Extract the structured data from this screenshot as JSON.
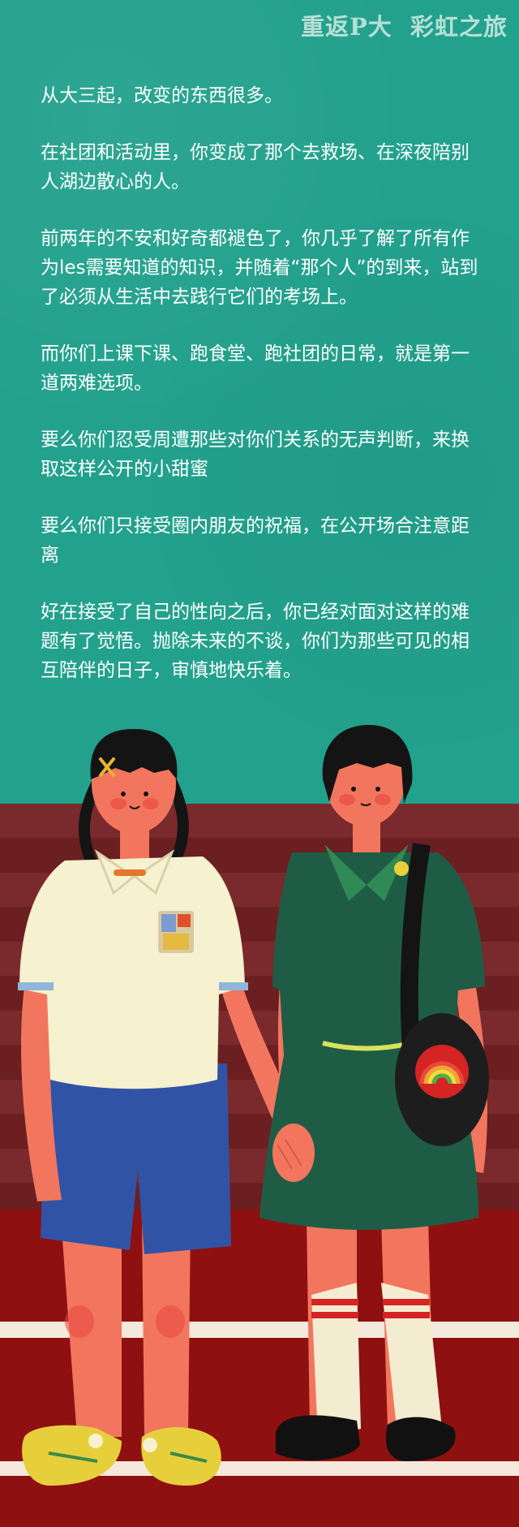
{
  "header": {
    "series_title": "重返P大  彩虹之旅"
  },
  "article": {
    "paragraphs": [
      "从大三起，改变的东西很多。",
      "在社团和活动里，你变成了那个去救场、在深夜陪别人湖边散心的人。",
      "前两年的不安和好奇都褪色了，你几乎了解了所有作为les需要知道的知识，并随着“那个人”的到来，站到了必须从生活中去践行它们的考场上。",
      "而你们上课下课、跑食堂、跑社团的日常，就是第一道两难选项。",
      "要么你们忍受周遭那些对你们关系的无声判断，来换取这样公开的小甜蜜",
      "要么你们只接受圈内朋友的祝福，在公开场合注意距离",
      "好在接受了自己的性向之后，你已经对面对这样的难题有了觉悟。抛除未来的不谈，你们为那些可见的相互陪伴的日子，审慎地快乐着。"
    ]
  },
  "illustration": {
    "subject": "two girls holding hands on a running track",
    "colors": {
      "teal_bg": "#22a18d",
      "stands_dark": "#6b1f21",
      "stands_light": "#7c2a2c",
      "track": "#8e1010",
      "track_line": "#f4e9dc",
      "skin": "#f2765e",
      "hair": "#141414",
      "shirt_cream": "#f6f1cf",
      "shorts_blue": "#3153a6",
      "uniform_green": "#1f5c46",
      "collar_green": "#2f8a55",
      "sneaker_yellow": "#e7cf3c",
      "sock_cream": "#f3ecd0",
      "sock_red": "#d62424",
      "shoe_black": "#111111"
    }
  }
}
